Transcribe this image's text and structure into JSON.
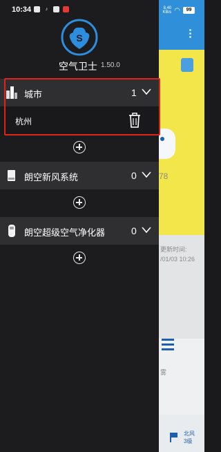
{
  "status_bar": {
    "time": "10:34",
    "speed_top": "8.40",
    "speed_bottom": "KB/s",
    "battery": "99"
  },
  "app": {
    "name": "空气卫士",
    "version": "1.50.0"
  },
  "groups": [
    {
      "label": "城市",
      "count": "1",
      "icon": "city-buildings-icon",
      "expanded": true,
      "items": [
        {
          "label": "杭州"
        }
      ]
    },
    {
      "label": "朗空新风系统",
      "count": "0",
      "icon": "fresh-air-unit-icon",
      "expanded": false
    },
    {
      "label": "朗空超级空气净化器",
      "count": "0",
      "icon": "air-purifier-icon",
      "expanded": false
    }
  ],
  "background": {
    "number_fragment": "78",
    "update_label": "更新时间:",
    "update_value": "/01/03 10:26",
    "weather_fragment": "雾",
    "wind_direction": "北风",
    "wind_level": "3级"
  },
  "colors": {
    "drawer_bg": "#1c1c1e",
    "row_bg": "#2f2f31",
    "highlight": "#e2231a",
    "logo_blue": "#2d8ee0"
  }
}
